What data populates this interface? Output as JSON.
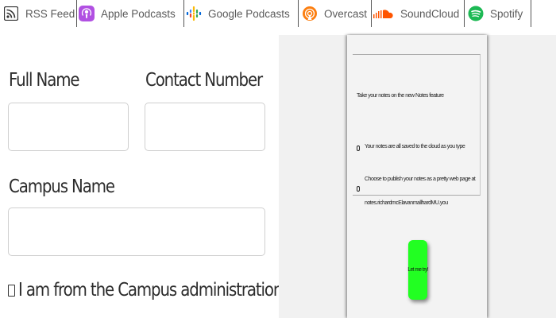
{
  "podcast_links": [
    {
      "id": "rss",
      "label": "RSS Feed",
      "icon": "rss-icon",
      "color": "#333333"
    },
    {
      "id": "apple",
      "label": "Apple Podcasts",
      "icon": "apple-podcasts-icon",
      "color": "#b150e2"
    },
    {
      "id": "google",
      "label": "Google Podcasts",
      "icon": "google-podcasts-icon",
      "color": "#4285f4"
    },
    {
      "id": "overcast",
      "label": "Overcast",
      "icon": "overcast-icon",
      "color": "#fc7e0f"
    },
    {
      "id": "soundcloud",
      "label": "SoundCloud",
      "icon": "soundcloud-icon",
      "color": "#ff5500"
    },
    {
      "id": "spotify",
      "label": "Spotify",
      "icon": "spotify-icon",
      "color": "#1db954"
    }
  ],
  "form": {
    "full_name_label": "Full Name",
    "full_name_value": "",
    "contact_number_label": "Contact Number",
    "contact_number_value": "",
    "campus_name_label": "Campus Name",
    "campus_name_value": "",
    "admin_checkbox_label": "I am from the Campus administration team",
    "admin_checkbox_checked": false
  },
  "preview": {
    "intro_text": "Take your notes on the new Notes feature",
    "bullet_1": "Your notes are all saved to the cloud as you type",
    "bullet_2_line1": "Choose to publish your notes as a pretty web page at",
    "bullet_2_line2": "notes.richardmcElavanmallhardMU.you",
    "button_label": "Let me try!",
    "button_color": "#22ff22"
  }
}
